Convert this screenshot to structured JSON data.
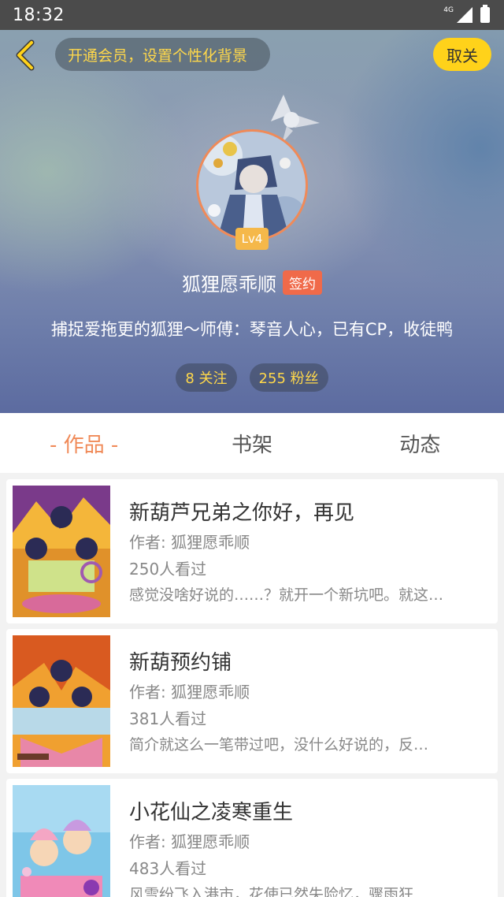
{
  "status_bar": {
    "time": "18:32",
    "network": "4G"
  },
  "header": {
    "vip_prompt": "开通会员，设置个性化背景",
    "unfollow_label": "取关",
    "level": "Lv4",
    "user_name": "狐狸愿乖顺",
    "sign_badge": "签约",
    "bio": "捕捉爱拖更的狐狸～师傅：琴音人心，已有CP，收徒鸭",
    "following": "8 关注",
    "followers": "255 粉丝"
  },
  "tabs": [
    {
      "label": "- 作品 -",
      "active": true
    },
    {
      "label": "书架",
      "active": false
    },
    {
      "label": "动态",
      "active": false
    }
  ],
  "books": [
    {
      "title": "新葫芦兄弟之你好，再见",
      "author": "作者: 狐狸愿乖顺",
      "views": "250人看过",
      "desc": "感觉没啥好说的……？就开一个新坑吧。就这…"
    },
    {
      "title": "新葫预约铺",
      "author": "作者: 狐狸愿乖顺",
      "views": "381人看过",
      "desc": "简介就这么一笔带过吧，没什么好说的，反…"
    },
    {
      "title": "小花仙之凌寒重生",
      "author": "作者: 狐狸愿乖顺",
      "views": "483人看过",
      "desc": "风雪纷飞入港市，花使已然失险忆，骤雨狂"
    }
  ],
  "colors": {
    "accent": "#f08a58",
    "vip_text": "#ffd84a",
    "unfollow_bg": "#ffd21a",
    "sign_bg": "#f06a4a"
  }
}
